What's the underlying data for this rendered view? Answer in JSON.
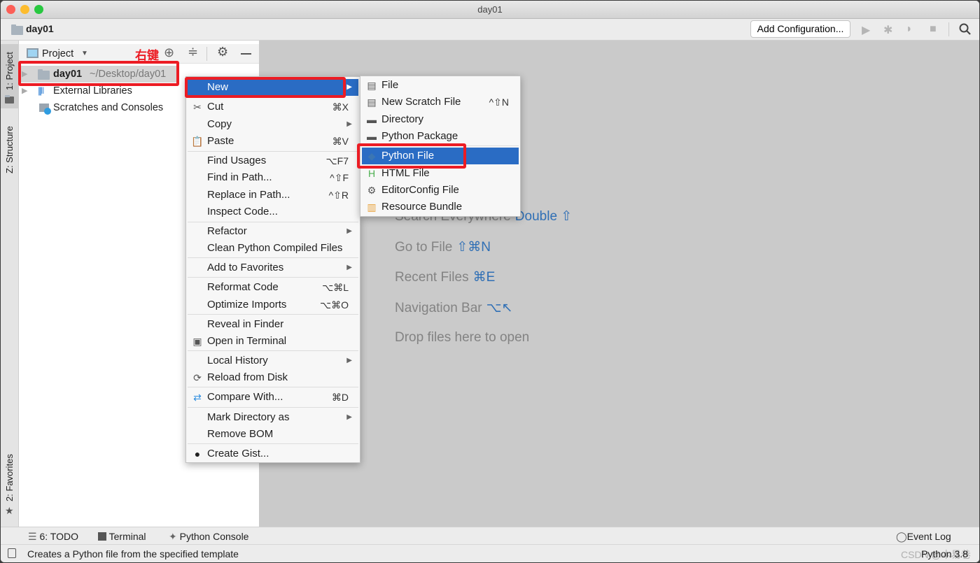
{
  "window": {
    "title": "day01"
  },
  "navbar": {
    "project": "day01",
    "add_configuration": "Add Configuration..."
  },
  "left_strip": {
    "project_tab": "1: Project",
    "structure_tab": "Z: Structure",
    "favorites_tab": "2: Favorites"
  },
  "project_panel": {
    "view_label": "Project",
    "annotation": "右键",
    "tree": [
      {
        "name": "day01",
        "path": "~/Desktop/day01"
      },
      {
        "name": "External Libraries"
      },
      {
        "name": "Scratches and Consoles"
      }
    ]
  },
  "context_menu": [
    {
      "label": "New",
      "submenu": true,
      "selected": true
    },
    {
      "label": "Cut",
      "shortcut": "⌘X",
      "icon": "scissors-icon"
    },
    {
      "label": "Copy",
      "submenu": true
    },
    {
      "label": "Paste",
      "shortcut": "⌘V",
      "icon": "clipboard-icon"
    },
    {
      "label": "Find Usages",
      "shortcut": "⌥F7"
    },
    {
      "label": "Find in Path...",
      "shortcut": "^⇧F"
    },
    {
      "label": "Replace in Path...",
      "shortcut": "^⇧R"
    },
    {
      "label": "Inspect Code..."
    },
    {
      "label": "Refactor",
      "submenu": true
    },
    {
      "label": "Clean Python Compiled Files"
    },
    {
      "label": "Add to Favorites",
      "submenu": true
    },
    {
      "label": "Reformat Code",
      "shortcut": "⌥⌘L"
    },
    {
      "label": "Optimize Imports",
      "shortcut": "⌥⌘O"
    },
    {
      "label": "Reveal in Finder"
    },
    {
      "label": "Open in Terminal",
      "icon": "terminal-icon"
    },
    {
      "label": "Local History",
      "submenu": true
    },
    {
      "label": "Reload from Disk",
      "icon": "reload-icon"
    },
    {
      "label": "Compare With...",
      "shortcut": "⌘D",
      "icon": "compare-icon"
    },
    {
      "label": "Mark Directory as",
      "submenu": true
    },
    {
      "label": "Remove BOM"
    },
    {
      "label": "Create Gist...",
      "icon": "github-icon"
    }
  ],
  "new_submenu": [
    {
      "label": "File",
      "icon": "file-icon"
    },
    {
      "label": "New Scratch File",
      "shortcut": "^⇧N",
      "icon": "scratch-file-icon"
    },
    {
      "label": "Directory",
      "icon": "folder-icon"
    },
    {
      "label": "Python Package",
      "icon": "package-icon"
    },
    {
      "label": "Python File",
      "icon": "python-file-icon",
      "selected": true
    },
    {
      "label": "HTML File",
      "icon": "html-file-icon"
    },
    {
      "label": "EditorConfig File",
      "icon": "gear-icon"
    },
    {
      "label": "Resource Bundle",
      "icon": "resource-bundle-icon"
    }
  ],
  "editor_hints": [
    {
      "text": "Search Everywhere",
      "shortcut": "Double ⇧"
    },
    {
      "text": "Go to File",
      "shortcut": "⇧⌘N"
    },
    {
      "text": "Recent Files",
      "shortcut": "⌘E"
    },
    {
      "text": "Navigation Bar",
      "shortcut": "⌥↖"
    },
    {
      "text": "Drop files here to open",
      "shortcut": ""
    }
  ],
  "bottom_bar": {
    "todo": "6: TODO",
    "terminal": "Terminal",
    "python_console": "Python Console",
    "event_log": "Event Log"
  },
  "status_bar": {
    "message": "Creates a Python file from the specified template",
    "interpreter": "Python 3.8",
    "watermark": "CSDN @木易巷"
  },
  "colors": {
    "selection": "#2a6cc4",
    "annotation_red": "#ec1c24",
    "hint_shortcut": "#2f6fb5"
  }
}
